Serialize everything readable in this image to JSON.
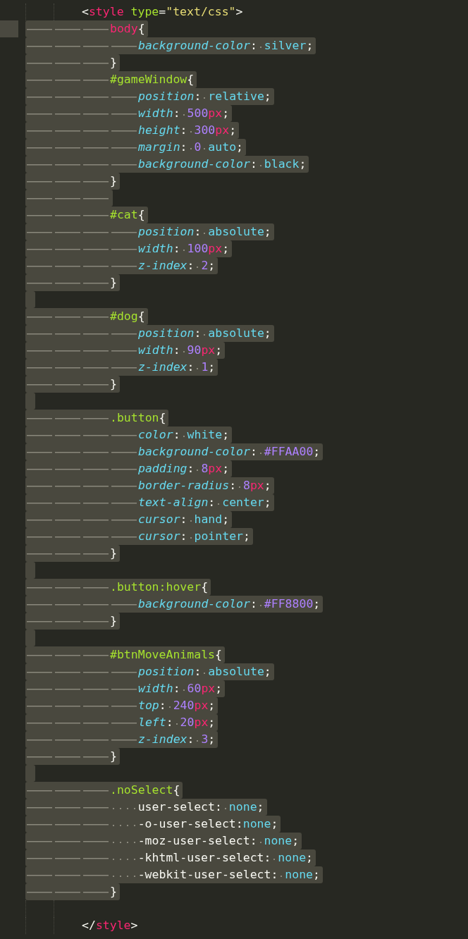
{
  "editor": {
    "lines": [
      {
        "selected": false,
        "current": false,
        "kind": "tab2",
        "tokens": [
          {
            "kind": "punct",
            "text": "<"
          },
          {
            "kind": "tag",
            "text": "style"
          },
          {
            "kind": "attr",
            "text": " type"
          },
          {
            "kind": "punct",
            "text": "="
          },
          {
            "kind": "string",
            "text": "\"text/css\""
          },
          {
            "kind": "punct",
            "text": ">"
          }
        ]
      },
      {
        "selected": true,
        "current": true,
        "kind": "tab3",
        "tokens": [
          {
            "kind": "tagsel",
            "text": "body"
          },
          {
            "kind": "punct",
            "text": "{"
          }
        ]
      },
      {
        "selected": true,
        "current": false,
        "kind": "tab4",
        "tokens": [
          {
            "kind": "prop",
            "text": "background-color"
          },
          {
            "kind": "punct",
            "text": ": "
          },
          {
            "kind": "value",
            "text": "silver"
          },
          {
            "kind": "punct",
            "text": ";"
          }
        ]
      },
      {
        "selected": true,
        "current": false,
        "kind": "tab3",
        "tokens": [
          {
            "kind": "punct",
            "text": "}"
          }
        ]
      },
      {
        "selected": true,
        "current": false,
        "kind": "tab3",
        "tokens": [
          {
            "kind": "selector",
            "text": "#gameWindow"
          },
          {
            "kind": "punct",
            "text": "{"
          }
        ]
      },
      {
        "selected": true,
        "current": false,
        "kind": "tab4",
        "tokens": [
          {
            "kind": "prop",
            "text": "position"
          },
          {
            "kind": "punct",
            "text": ": "
          },
          {
            "kind": "value",
            "text": "relative"
          },
          {
            "kind": "punct",
            "text": ";"
          }
        ]
      },
      {
        "selected": true,
        "current": false,
        "kind": "tab4",
        "tokens": [
          {
            "kind": "prop",
            "text": "width"
          },
          {
            "kind": "punct",
            "text": ": "
          },
          {
            "kind": "number",
            "text": "500"
          },
          {
            "kind": "unit",
            "text": "px"
          },
          {
            "kind": "punct",
            "text": ";"
          }
        ]
      },
      {
        "selected": true,
        "current": false,
        "kind": "tab4",
        "tokens": [
          {
            "kind": "prop",
            "text": "height"
          },
          {
            "kind": "punct",
            "text": ": "
          },
          {
            "kind": "number",
            "text": "300"
          },
          {
            "kind": "unit",
            "text": "px"
          },
          {
            "kind": "punct",
            "text": ";"
          }
        ]
      },
      {
        "selected": true,
        "current": false,
        "kind": "tab4",
        "tokens": [
          {
            "kind": "prop",
            "text": "margin"
          },
          {
            "kind": "punct",
            "text": ": "
          },
          {
            "kind": "number",
            "text": "0"
          },
          {
            "kind": "value",
            "text": " auto"
          },
          {
            "kind": "punct",
            "text": ";"
          }
        ]
      },
      {
        "selected": true,
        "current": false,
        "kind": "tab4",
        "tokens": [
          {
            "kind": "prop",
            "text": "background-color"
          },
          {
            "kind": "punct",
            "text": ": "
          },
          {
            "kind": "value",
            "text": "black"
          },
          {
            "kind": "punct",
            "text": ";"
          }
        ]
      },
      {
        "selected": true,
        "current": false,
        "kind": "tab3",
        "tokens": [
          {
            "kind": "punct",
            "text": "}"
          }
        ]
      },
      {
        "selected": true,
        "current": false,
        "kind": "tab3"
      },
      {
        "selected": true,
        "current": false,
        "kind": "tab3",
        "tokens": [
          {
            "kind": "selector",
            "text": "#cat"
          },
          {
            "kind": "punct",
            "text": "{"
          }
        ]
      },
      {
        "selected": true,
        "current": false,
        "kind": "tab4",
        "tokens": [
          {
            "kind": "prop",
            "text": "position"
          },
          {
            "kind": "punct",
            "text": ": "
          },
          {
            "kind": "value",
            "text": "absolute"
          },
          {
            "kind": "punct",
            "text": ";"
          }
        ]
      },
      {
        "selected": true,
        "current": false,
        "kind": "tab4",
        "tokens": [
          {
            "kind": "prop",
            "text": "width"
          },
          {
            "kind": "punct",
            "text": ": "
          },
          {
            "kind": "number",
            "text": "100"
          },
          {
            "kind": "unit",
            "text": "px"
          },
          {
            "kind": "punct",
            "text": ";"
          }
        ]
      },
      {
        "selected": true,
        "current": false,
        "kind": "tab4",
        "tokens": [
          {
            "kind": "prop",
            "text": "z-index"
          },
          {
            "kind": "punct",
            "text": ": "
          },
          {
            "kind": "number",
            "text": "2"
          },
          {
            "kind": "punct",
            "text": ";"
          }
        ]
      },
      {
        "selected": true,
        "current": false,
        "kind": "tab3",
        "tokens": [
          {
            "kind": "punct",
            "text": "}"
          }
        ]
      },
      {
        "selected": true,
        "current": false,
        "kind": "blank"
      },
      {
        "selected": true,
        "current": false,
        "kind": "tab3",
        "tokens": [
          {
            "kind": "selector",
            "text": "#dog"
          },
          {
            "kind": "punct",
            "text": "{"
          }
        ]
      },
      {
        "selected": true,
        "current": false,
        "kind": "tab4",
        "tokens": [
          {
            "kind": "prop",
            "text": "position"
          },
          {
            "kind": "punct",
            "text": ": "
          },
          {
            "kind": "value",
            "text": "absolute"
          },
          {
            "kind": "punct",
            "text": ";"
          }
        ]
      },
      {
        "selected": true,
        "current": false,
        "kind": "tab4",
        "tokens": [
          {
            "kind": "prop",
            "text": "width"
          },
          {
            "kind": "punct",
            "text": ": "
          },
          {
            "kind": "number",
            "text": "90"
          },
          {
            "kind": "unit",
            "text": "px"
          },
          {
            "kind": "punct",
            "text": ";"
          }
        ]
      },
      {
        "selected": true,
        "current": false,
        "kind": "tab4",
        "tokens": [
          {
            "kind": "prop",
            "text": "z-index"
          },
          {
            "kind": "punct",
            "text": ": "
          },
          {
            "kind": "number",
            "text": "1"
          },
          {
            "kind": "punct",
            "text": ";"
          }
        ]
      },
      {
        "selected": true,
        "current": false,
        "kind": "tab3",
        "tokens": [
          {
            "kind": "punct",
            "text": "}"
          }
        ]
      },
      {
        "selected": true,
        "current": false,
        "kind": "blank"
      },
      {
        "selected": true,
        "current": false,
        "kind": "tab3",
        "tokens": [
          {
            "kind": "selector",
            "text": ".button"
          },
          {
            "kind": "punct",
            "text": "{"
          }
        ]
      },
      {
        "selected": true,
        "current": false,
        "kind": "tab4",
        "tokens": [
          {
            "kind": "prop",
            "text": "color"
          },
          {
            "kind": "punct",
            "text": ": "
          },
          {
            "kind": "value",
            "text": "white"
          },
          {
            "kind": "punct",
            "text": ";"
          }
        ]
      },
      {
        "selected": true,
        "current": false,
        "kind": "tab4",
        "tokens": [
          {
            "kind": "prop",
            "text": "background-color"
          },
          {
            "kind": "punct",
            "text": ": "
          },
          {
            "kind": "number",
            "text": "#FFAA00"
          },
          {
            "kind": "punct",
            "text": ";"
          }
        ]
      },
      {
        "selected": true,
        "current": false,
        "kind": "tab4",
        "tokens": [
          {
            "kind": "prop",
            "text": "padding"
          },
          {
            "kind": "punct",
            "text": ": "
          },
          {
            "kind": "number",
            "text": "8"
          },
          {
            "kind": "unit",
            "text": "px"
          },
          {
            "kind": "punct",
            "text": ";"
          }
        ]
      },
      {
        "selected": true,
        "current": false,
        "kind": "tab4",
        "tokens": [
          {
            "kind": "prop",
            "text": "border-radius"
          },
          {
            "kind": "punct",
            "text": ": "
          },
          {
            "kind": "number",
            "text": "8"
          },
          {
            "kind": "unit",
            "text": "px"
          },
          {
            "kind": "punct",
            "text": ";"
          }
        ]
      },
      {
        "selected": true,
        "current": false,
        "kind": "tab4",
        "tokens": [
          {
            "kind": "prop",
            "text": "text-align"
          },
          {
            "kind": "punct",
            "text": ": "
          },
          {
            "kind": "value",
            "text": "center"
          },
          {
            "kind": "punct",
            "text": ";"
          }
        ]
      },
      {
        "selected": true,
        "current": false,
        "kind": "tab4",
        "tokens": [
          {
            "kind": "prop",
            "text": "cursor"
          },
          {
            "kind": "punct",
            "text": ": "
          },
          {
            "kind": "value",
            "text": "hand"
          },
          {
            "kind": "punct",
            "text": ";"
          }
        ]
      },
      {
        "selected": true,
        "current": false,
        "kind": "tab4",
        "tokens": [
          {
            "kind": "prop",
            "text": "cursor"
          },
          {
            "kind": "punct",
            "text": ": "
          },
          {
            "kind": "value",
            "text": "pointer"
          },
          {
            "kind": "punct",
            "text": ";"
          }
        ]
      },
      {
        "selected": true,
        "current": false,
        "kind": "tab3",
        "tokens": [
          {
            "kind": "punct",
            "text": "}"
          }
        ]
      },
      {
        "selected": true,
        "current": false,
        "kind": "blank"
      },
      {
        "selected": true,
        "current": false,
        "kind": "tab3",
        "tokens": [
          {
            "kind": "selector",
            "text": ".button:hover"
          },
          {
            "kind": "punct",
            "text": "{"
          }
        ]
      },
      {
        "selected": true,
        "current": false,
        "kind": "tab4",
        "tokens": [
          {
            "kind": "prop",
            "text": "background-color"
          },
          {
            "kind": "punct",
            "text": ": "
          },
          {
            "kind": "number",
            "text": "#FF8800"
          },
          {
            "kind": "punct",
            "text": ";"
          }
        ]
      },
      {
        "selected": true,
        "current": false,
        "kind": "tab3",
        "tokens": [
          {
            "kind": "punct",
            "text": "}"
          }
        ]
      },
      {
        "selected": true,
        "current": false,
        "kind": "blank"
      },
      {
        "selected": true,
        "current": false,
        "kind": "tab3",
        "tokens": [
          {
            "kind": "selector",
            "text": "#btnMoveAnimals"
          },
          {
            "kind": "punct",
            "text": "{"
          }
        ]
      },
      {
        "selected": true,
        "current": false,
        "kind": "tab4",
        "tokens": [
          {
            "kind": "prop",
            "text": "position"
          },
          {
            "kind": "punct",
            "text": ": "
          },
          {
            "kind": "value",
            "text": "absolute"
          },
          {
            "kind": "punct",
            "text": ";"
          }
        ]
      },
      {
        "selected": true,
        "current": false,
        "kind": "tab4",
        "tokens": [
          {
            "kind": "prop",
            "text": "width"
          },
          {
            "kind": "punct",
            "text": ": "
          },
          {
            "kind": "number",
            "text": "60"
          },
          {
            "kind": "unit",
            "text": "px"
          },
          {
            "kind": "punct",
            "text": ";"
          }
        ]
      },
      {
        "selected": true,
        "current": false,
        "kind": "tab4",
        "tokens": [
          {
            "kind": "prop",
            "text": "top"
          },
          {
            "kind": "punct",
            "text": ": "
          },
          {
            "kind": "number",
            "text": "240"
          },
          {
            "kind": "unit",
            "text": "px"
          },
          {
            "kind": "punct",
            "text": ";"
          }
        ]
      },
      {
        "selected": true,
        "current": false,
        "kind": "tab4",
        "tokens": [
          {
            "kind": "prop",
            "text": "left"
          },
          {
            "kind": "punct",
            "text": ": "
          },
          {
            "kind": "number",
            "text": "20"
          },
          {
            "kind": "unit",
            "text": "px"
          },
          {
            "kind": "punct",
            "text": ";"
          }
        ]
      },
      {
        "selected": true,
        "current": false,
        "kind": "tab4",
        "tokens": [
          {
            "kind": "prop",
            "text": "z-index"
          },
          {
            "kind": "punct",
            "text": ": "
          },
          {
            "kind": "number",
            "text": "3"
          },
          {
            "kind": "punct",
            "text": ";"
          }
        ]
      },
      {
        "selected": true,
        "current": false,
        "kind": "tab3",
        "tokens": [
          {
            "kind": "punct",
            "text": "}"
          }
        ]
      },
      {
        "selected": true,
        "current": false,
        "kind": "blank"
      },
      {
        "selected": true,
        "current": false,
        "kind": "tab3",
        "tokens": [
          {
            "kind": "selector",
            "text": ".noSelect"
          },
          {
            "kind": "punct",
            "text": "{"
          }
        ]
      },
      {
        "selected": true,
        "current": false,
        "kind": "tab3space4",
        "tokens": [
          {
            "kind": "punct",
            "text": "user-select: "
          },
          {
            "kind": "value",
            "text": "none"
          },
          {
            "kind": "punct",
            "text": ";"
          }
        ]
      },
      {
        "selected": true,
        "current": false,
        "kind": "tab3space4",
        "tokens": [
          {
            "kind": "punct",
            "text": "-o-user-select:"
          },
          {
            "kind": "value",
            "text": "none"
          },
          {
            "kind": "punct",
            "text": ";"
          }
        ]
      },
      {
        "selected": true,
        "current": false,
        "kind": "tab3space4",
        "tokens": [
          {
            "kind": "punct",
            "text": "-moz-user-select: "
          },
          {
            "kind": "value",
            "text": "none"
          },
          {
            "kind": "punct",
            "text": ";"
          }
        ]
      },
      {
        "selected": true,
        "current": false,
        "kind": "tab3space4",
        "tokens": [
          {
            "kind": "punct",
            "text": "-khtml-user-select: "
          },
          {
            "kind": "value",
            "text": "none"
          },
          {
            "kind": "punct",
            "text": ";"
          }
        ]
      },
      {
        "selected": true,
        "current": false,
        "kind": "tab3space4",
        "tokens": [
          {
            "kind": "punct",
            "text": "-webkit-user-select: "
          },
          {
            "kind": "value",
            "text": "none"
          },
          {
            "kind": "punct",
            "text": ";"
          }
        ]
      },
      {
        "selected": true,
        "current": false,
        "kind": "tab3",
        "tokens": [
          {
            "kind": "punct",
            "text": "}"
          }
        ]
      },
      {
        "selected": false,
        "current": false,
        "kind": "tab2"
      },
      {
        "selected": false,
        "current": false,
        "kind": "tab2",
        "tokens": [
          {
            "kind": "punct",
            "text": "</"
          },
          {
            "kind": "tag",
            "text": "style"
          },
          {
            "kind": "punct",
            "text": ">"
          }
        ]
      }
    ]
  }
}
